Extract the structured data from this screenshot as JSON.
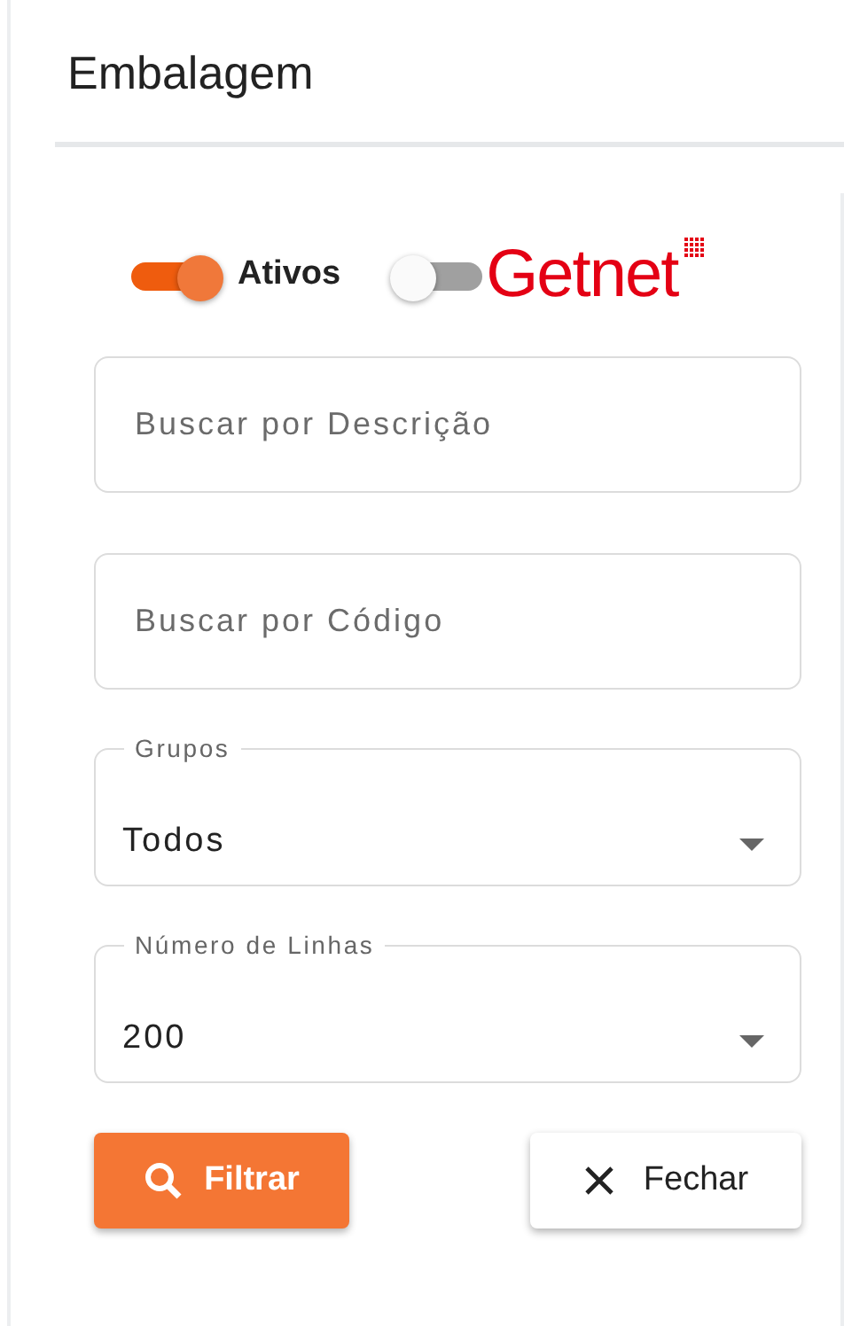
{
  "title": "Embalagem",
  "toggles": [
    {
      "kind": "label",
      "label": "Ativos",
      "on": true
    },
    {
      "kind": "logo",
      "label": "Getnet",
      "on": false
    }
  ],
  "fields": [
    {
      "kind": "text",
      "placeholder": "Buscar por Descrição"
    },
    {
      "kind": "text",
      "placeholder": "Buscar por Código"
    },
    {
      "kind": "select",
      "label": "Grupos",
      "value": "Todos"
    },
    {
      "kind": "select",
      "label": "Número de Linhas",
      "value": "200"
    }
  ],
  "buttons": [
    {
      "kind": "primary",
      "label": "Filtrar"
    },
    {
      "kind": "secondary",
      "label": "Fechar"
    }
  ]
}
